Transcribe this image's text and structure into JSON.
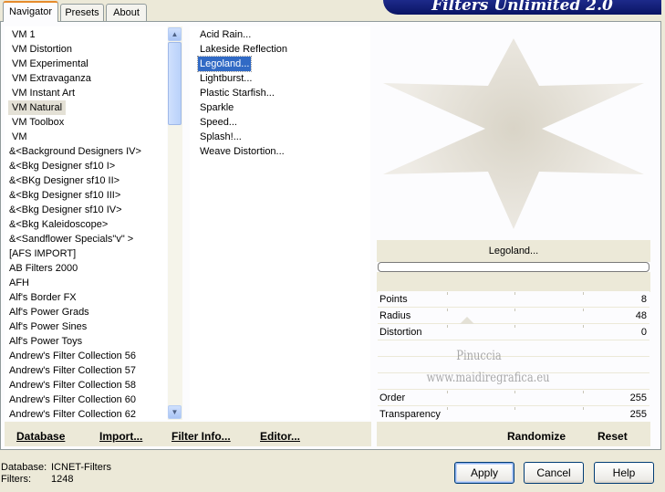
{
  "banner_title": "Filters Unlimited 2.0",
  "tabs": [
    {
      "label": "Navigator",
      "active": true
    },
    {
      "label": "Presets",
      "active": false
    },
    {
      "label": "About",
      "active": false
    }
  ],
  "categories": [
    "VM 1",
    "VM Distortion",
    "VM Experimental",
    "VM Extravaganza",
    "VM Instant Art",
    "VM Natural",
    "VM Toolbox",
    "VM",
    "&<Background Designers IV>",
    "&<Bkg Designer sf10 I>",
    "&<BKg Designer sf10 II>",
    "&<Bkg Designer sf10 III>",
    "&<Bkg Designer sf10 IV>",
    "&<Bkg Kaleidoscope>",
    "&<Sandflower Specials\"v\" >",
    "[AFS IMPORT]",
    "AB Filters 2000",
    "AFH",
    "Alf's Border FX",
    "Alf's Power Grads",
    "Alf's Power Sines",
    "Alf's Power Toys",
    "Andrew's Filter Collection 56",
    "Andrew's Filter Collection 57",
    "Andrew's Filter Collection 58",
    "Andrew's Filter Collection 60",
    "Andrew's Filter Collection 62"
  ],
  "selected_category": "VM Natural",
  "filters": [
    "Acid Rain...",
    "Lakeside Reflection",
    "Legoland...",
    "Lightburst...",
    "Plastic Starfish...",
    "Sparkle",
    "Speed...",
    "Splash!...",
    "Weave Distortion..."
  ],
  "selected_filter": "Legoland...",
  "preview_caption": "Legoland...",
  "params": [
    {
      "name": "Points",
      "value": "8",
      "slider": 0
    },
    {
      "name": "Radius",
      "value": "48",
      "slider": 0.19
    },
    {
      "name": "Distortion",
      "value": "0",
      "slider": 0
    },
    {
      "name": "",
      "value": "",
      "slider": null
    },
    {
      "name": "",
      "value": "",
      "slider": null
    },
    {
      "name": "",
      "value": "",
      "slider": null
    },
    {
      "name": "Order",
      "value": "255",
      "slider": 1
    },
    {
      "name": "Transparency",
      "value": "255",
      "slider": 1
    }
  ],
  "watermark": [
    "Pinuccia",
    "www.maidiregrafica.eu"
  ],
  "left_links": [
    {
      "label": "Database"
    },
    {
      "label": "Import..."
    },
    {
      "label": "Filter Info..."
    },
    {
      "label": "Editor..."
    }
  ],
  "right_links": {
    "randomize": "Randomize",
    "reset": "Reset"
  },
  "status": {
    "database_label": "Database:",
    "database_value": "ICNET-Filters",
    "filters_label": "Filters:",
    "filters_value": "1248"
  },
  "buttons": {
    "apply": "Apply",
    "cancel": "Cancel",
    "help": "Help"
  },
  "colors": {
    "accent_tab": "#e68b2c",
    "selection": "#316ac5",
    "banner": "#0a1464",
    "star": "#e2ddd2"
  }
}
